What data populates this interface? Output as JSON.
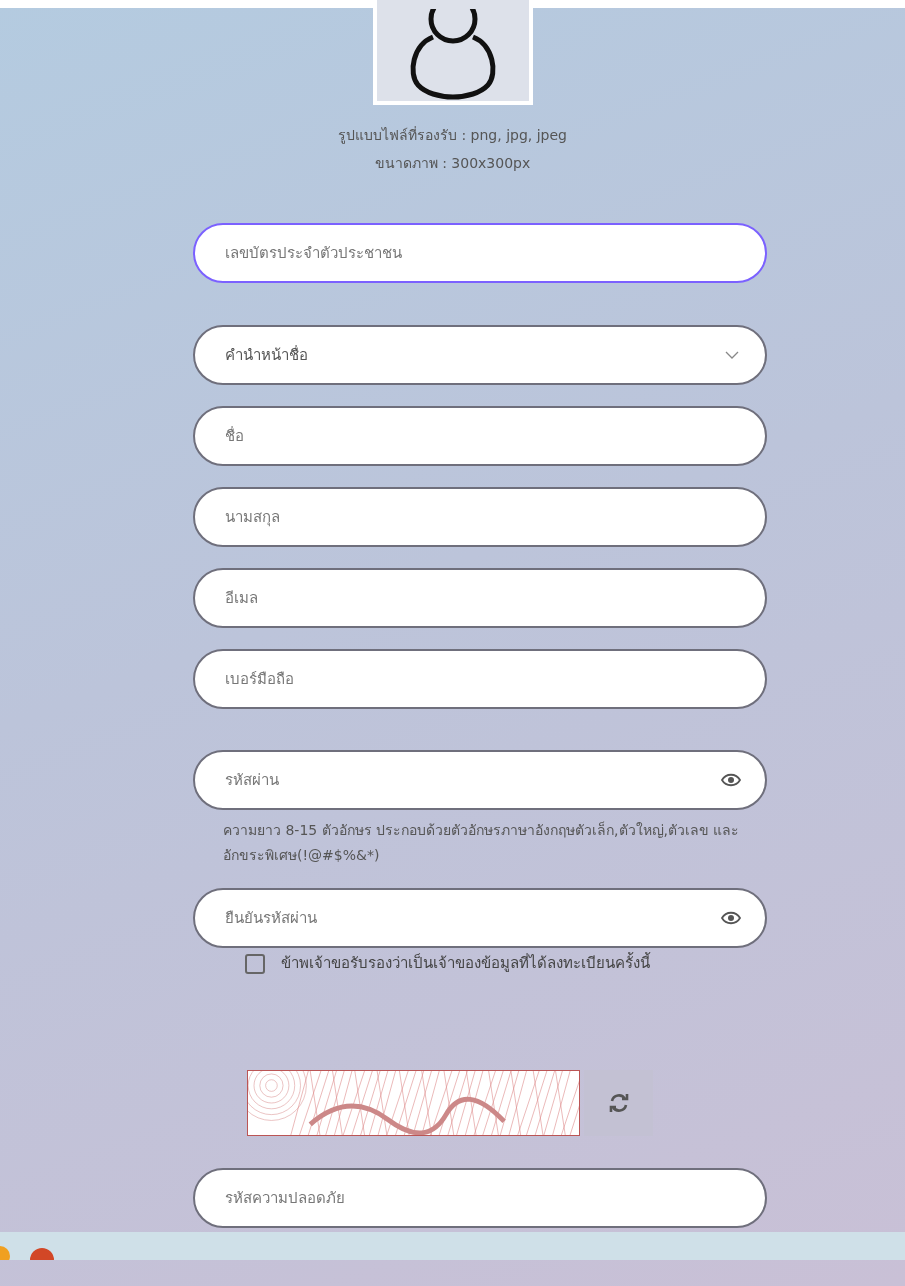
{
  "upload": {
    "formats": "รูปแบบไฟล์ที่รองรับ : png, jpg, jpeg",
    "size": "ขนาดภาพ : 300x300px"
  },
  "fields": [
    {
      "kind": "text",
      "placeholder": "เลขบัตรประจำตัวประชาชน",
      "focused": true
    },
    {
      "kind": "select",
      "placeholder": "คำนำหน้าชื่อ",
      "focused": false
    },
    {
      "kind": "text",
      "placeholder": "ชื่อ",
      "focused": false
    },
    {
      "kind": "text",
      "placeholder": "นามสกุล",
      "focused": false
    },
    {
      "kind": "text",
      "placeholder": "อีเมล",
      "focused": false
    },
    {
      "kind": "text",
      "placeholder": "เบอร์มือถือ",
      "focused": false
    },
    {
      "kind": "password",
      "placeholder": "รหัสผ่าน",
      "focused": false,
      "hint": "ความยาว 8-15 ตัวอักษร ประกอบด้วยตัวอักษรภาษาอังกฤษตัวเล็ก,ตัวใหญ่,ตัวเลข และอักขระพิเศษ(!@#$%&*)"
    },
    {
      "kind": "password",
      "placeholder": "ยืนยันรหัสผ่าน",
      "focused": false
    }
  ],
  "consent": {
    "label": "ข้าพเจ้าขอรับรองว่าเป็นเจ้าของข้อมูลที่ได้ลงทะเบียนครั้งนี้",
    "checked": false
  },
  "security_code": {
    "placeholder": "รหัสความปลอดภัย"
  }
}
